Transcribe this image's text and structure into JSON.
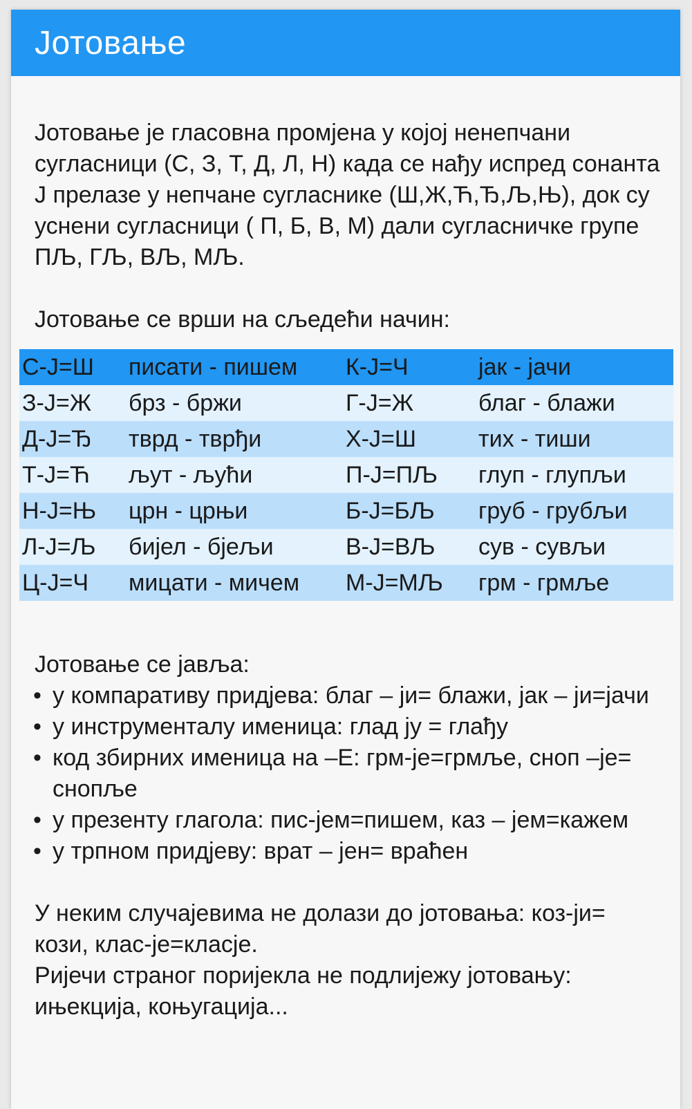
{
  "header": {
    "title": "Јотовање"
  },
  "intro": "Јотовање је гласовна промјена у којој ненепчани сугласници (С, З, Т, Д, Л, Н) када се нађу испред сонанта Ј прелазе у непчане сугласнике (Ш,Ж,Ћ,Ђ,Љ,Њ), док су уснени сугласници ( П, Б, В, М) дали сугласничке групе ПЉ, ГЉ, ВЉ, МЉ.",
  "subhead": "Јотовање се врши на сљедећи начин:",
  "table": {
    "rows": [
      [
        "С-Ј=Ш",
        "писати - пишем",
        "К-Ј=Ч",
        "јак - јачи"
      ],
      [
        "З-Ј=Ж",
        "брз - бржи",
        "Г-Ј=Ж",
        "благ - блажи"
      ],
      [
        "Д-Ј=Ђ",
        "тврд - тврђи",
        "Х-Ј=Ш",
        "тих - тиши"
      ],
      [
        "Т-Ј=Ћ",
        "љут - љући",
        "П-Ј=ПЉ",
        "глуп - глупљи"
      ],
      [
        "Н-Ј=Њ",
        "црн - црњи",
        "Б-Ј=БЉ",
        "груб - грубљи"
      ],
      [
        "Л-Ј=Љ",
        "бијел - бјељи",
        "В-Ј=ВЉ",
        "сув - сувљи"
      ],
      [
        "Ц-Ј=Ч",
        "мицати - мичем",
        "М-Ј=МЉ",
        "грм - грмље"
      ]
    ]
  },
  "occurs": {
    "heading": "Јотовање се јавља:",
    "bullet": "•",
    "items": [
      "у компаративу придјева: благ – ји= блажи, јак – ји=јачи",
      "у инструменталу именица: глад ју = глађу",
      "код збирних именица на –Е: грм-је=грмље, сноп –је= снопље",
      "у презенту глагола: пис-јем=пишем, каз – јем=кажем",
      "у трпном придјеву: врат – јен= враћен"
    ]
  },
  "closing": {
    "line1": "У неким случајевима не долази до јотовања: коз-ји= кози, клас-је=класје.",
    "line2": "Ријечи страног поријекла не подлијежу јотовању: ињекција, коњугација..."
  },
  "colors": {
    "accent": "#2196f3",
    "row_dark": "#bbdefb",
    "row_light": "#e3f2fd"
  }
}
